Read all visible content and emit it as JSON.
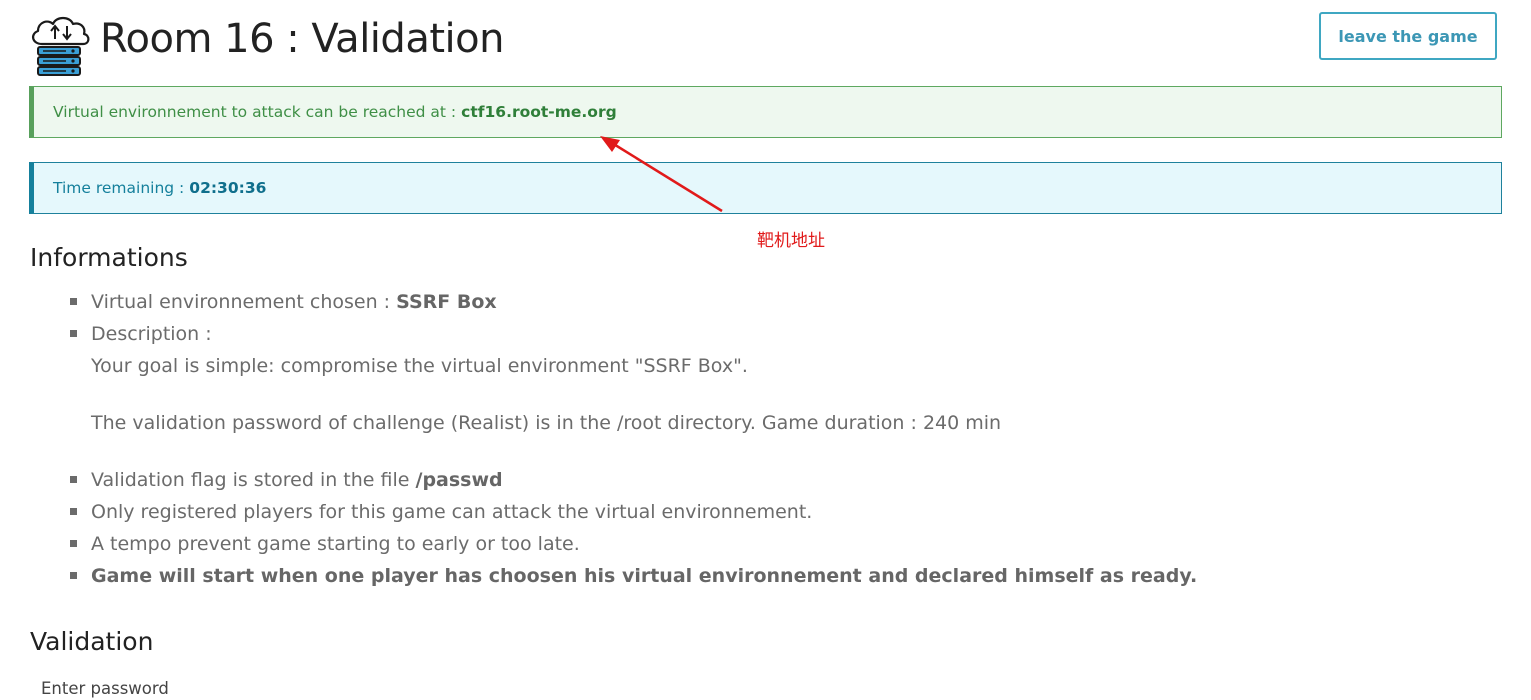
{
  "header": {
    "title": "Room 16 : Validation",
    "logo_icon": "cloud-server-icon",
    "leave_button": "leave the game"
  },
  "alerts": {
    "environment": {
      "text": "Virtual environnement to attack can be reached at :",
      "host": "ctf16.root-me.org"
    },
    "timer": {
      "text": "Time remaining :",
      "value": "02:30:36"
    }
  },
  "annotation": {
    "text": "靶机地址",
    "color": "#e11a1a"
  },
  "informations": {
    "heading": "Informations",
    "env_chosen_label": "Virtual environnement chosen :",
    "env_chosen_value": "SSRF Box",
    "description_label": "Description :",
    "description_line1": "Your goal is simple: compromise the virtual environment \"SSRF Box\".",
    "description_line2": "The validation password of challenge (Realist) is in the /root directory. Game duration : 240 min",
    "flag_label": "Validation flag is stored in the file",
    "flag_file": "/passwd",
    "registered_note": "Only registered players for this game can attack the virtual environnement.",
    "tempo_note": "A tempo prevent game starting to early or too late.",
    "start_note": "Game will start when one player has choosen his virtual environnement and declared himself as ready."
  },
  "validation": {
    "heading": "Validation",
    "password_label": "Enter password"
  },
  "colors": {
    "accent_blue": "#3c97b5",
    "success_green": "#3f8f46",
    "info_teal": "#15809c"
  }
}
